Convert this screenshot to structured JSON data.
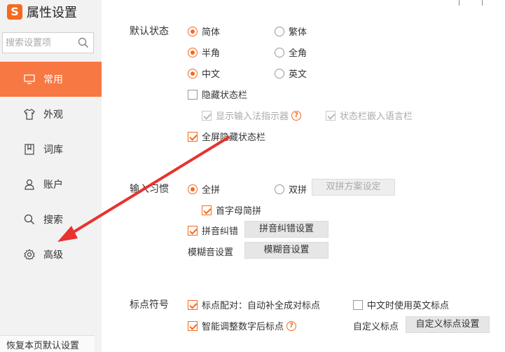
{
  "app": {
    "logo": "S",
    "title": "属性设置"
  },
  "search": {
    "placeholder": "搜索设置项"
  },
  "nav": [
    {
      "label": "常用",
      "icon": "monitor-icon",
      "active": true
    },
    {
      "label": "外观",
      "icon": "shirt-icon"
    },
    {
      "label": "词库",
      "icon": "book-icon"
    },
    {
      "label": "账户",
      "icon": "user-icon"
    },
    {
      "label": "搜索",
      "icon": "search-icon"
    },
    {
      "label": "高级",
      "icon": "gear-icon"
    }
  ],
  "footer": {
    "restore_label": "恢复本页默认设置"
  },
  "sections": {
    "default_state": {
      "label": "默认状态",
      "simplified": "简体",
      "traditional": "繁体",
      "half_width": "半角",
      "full_width": "全角",
      "chinese": "中文",
      "english": "英文",
      "hide_status_bar": "隐藏状态栏",
      "show_ime_indicator": "显示输入法指示器",
      "embed_language_bar": "状态栏嵌入语言栏",
      "fullscreen_hide": "全屏隐藏状态栏"
    },
    "input_habit": {
      "label": "输入习惯",
      "full_pinyin": "全拼",
      "double_pinyin": "双拼",
      "double_pinyin_settings": "双拼方案设定",
      "initial_abbrev": "首字母简拼",
      "pinyin_correction": "拼音纠错",
      "pinyin_correction_settings": "拼音纠错设置",
      "fuzzy_label": "模糊音设置",
      "fuzzy_button": "模糊音设置"
    },
    "punctuation": {
      "label": "标点符号",
      "auto_pair": "标点配对：自动补全成对标点",
      "english_punct_in_chinese": "中文时使用英文标点",
      "smart_digit_punct": "智能调整数字后标点",
      "custom_label": "自定义标点",
      "custom_button": "自定义标点设置"
    }
  },
  "colors": {
    "accent": "#f56a1e",
    "active_nav": "#f77842",
    "arrow": "#e8332e"
  }
}
